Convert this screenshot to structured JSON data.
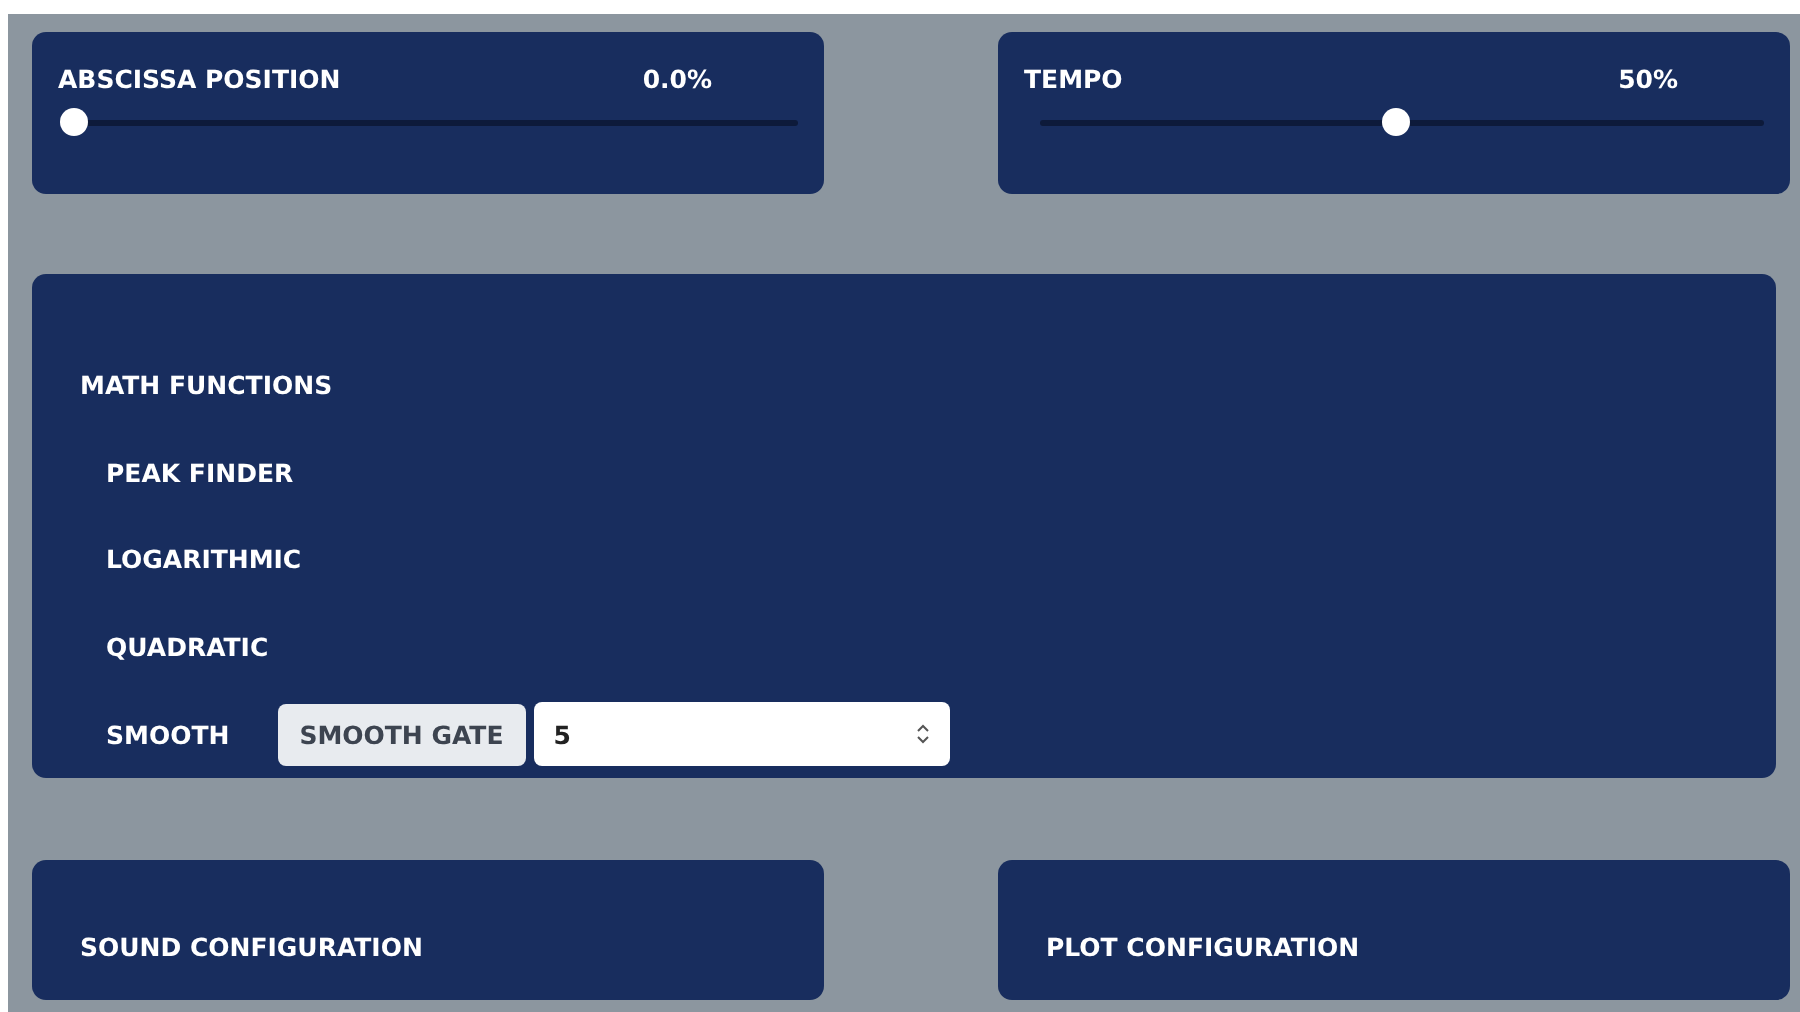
{
  "sliders": [
    {
      "label": "ABSCISSA POSITION",
      "reading": "0.0%",
      "level": 0
    },
    {
      "label": "TEMPO",
      "reading": "50%",
      "level": 0.5
    }
  ],
  "math_functions": {
    "title": "MATH FUNCTIONS",
    "items": [
      {
        "kind": "label",
        "label": "PEAK FINDER"
      },
      {
        "kind": "label",
        "label": "LOGARITHMIC"
      },
      {
        "kind": "label",
        "label": "QUADRATIC"
      },
      {
        "kind": "input",
        "label": "SMOOTH",
        "addon": "SMOOTH GATE",
        "value": "5"
      }
    ]
  },
  "config_panels": [
    {
      "title": "SOUND CONFIGURATION"
    },
    {
      "title": "PLOT CONFIGURATION"
    }
  ]
}
